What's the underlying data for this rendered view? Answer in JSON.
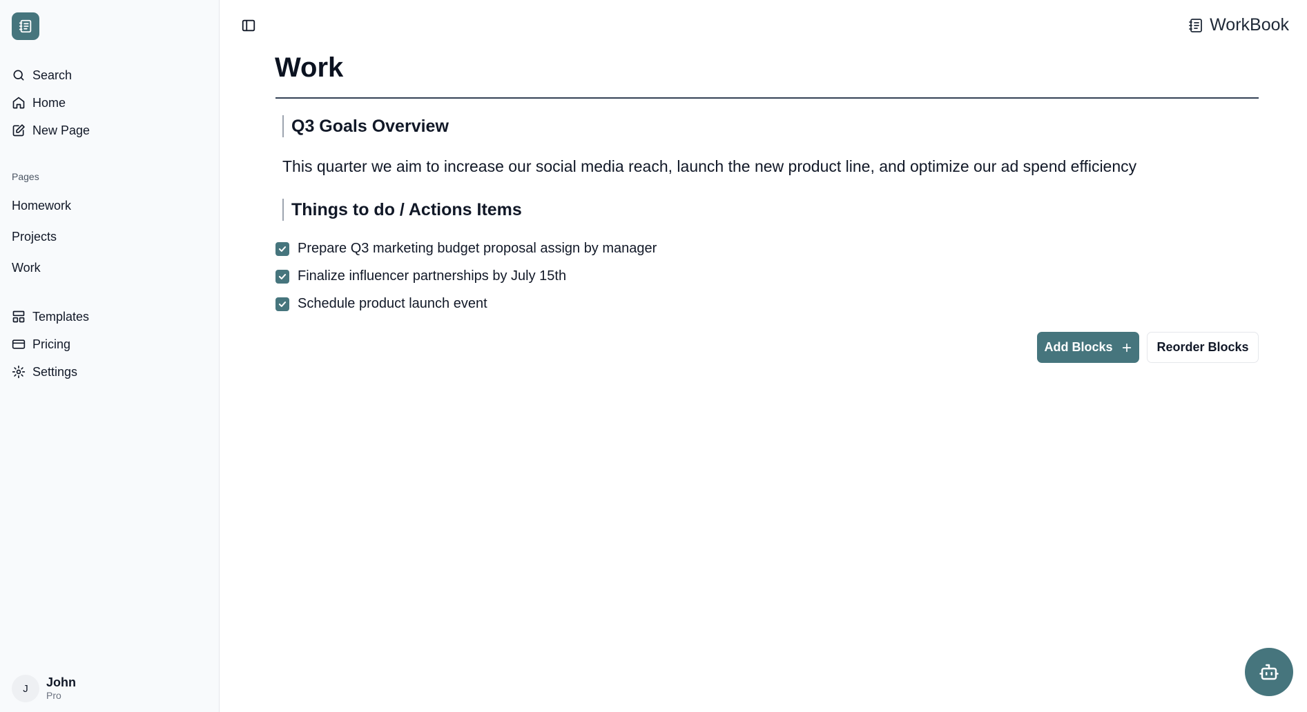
{
  "brand": {
    "name": "WorkBook"
  },
  "sidebar": {
    "nav": [
      {
        "label": "Search",
        "icon": "search-icon"
      },
      {
        "label": "Home",
        "icon": "home-icon"
      },
      {
        "label": "New Page",
        "icon": "edit-icon"
      }
    ],
    "pages_label": "Pages",
    "pages": [
      "Homework",
      "Projects",
      "Work"
    ],
    "bottom_nav": [
      {
        "label": "Templates",
        "icon": "templates-icon"
      },
      {
        "label": "Pricing",
        "icon": "credit-card-icon"
      },
      {
        "label": "Settings",
        "icon": "gear-icon"
      }
    ],
    "user": {
      "initial": "J",
      "name": "John",
      "plan": "Pro"
    }
  },
  "main": {
    "title": "Work",
    "heading1": "Q3 Goals Overview",
    "paragraph": "This quarter we aim to increase our social media reach, launch the new product line, and optimize our ad spend efficiency",
    "heading2": "Things to do / Actions Items",
    "todos": [
      {
        "text": "Prepare Q3 marketing budget proposal assign by manager",
        "checked": true
      },
      {
        "text": "Finalize influencer partnerships by July 15th",
        "checked": true
      },
      {
        "text": "Schedule product launch event",
        "checked": true
      }
    ],
    "add_blocks_label": "Add Blocks",
    "reorder_blocks_label": "Reorder Blocks"
  },
  "colors": {
    "accent": "#46757d",
    "sidebar_bg": "#f8fafc"
  }
}
